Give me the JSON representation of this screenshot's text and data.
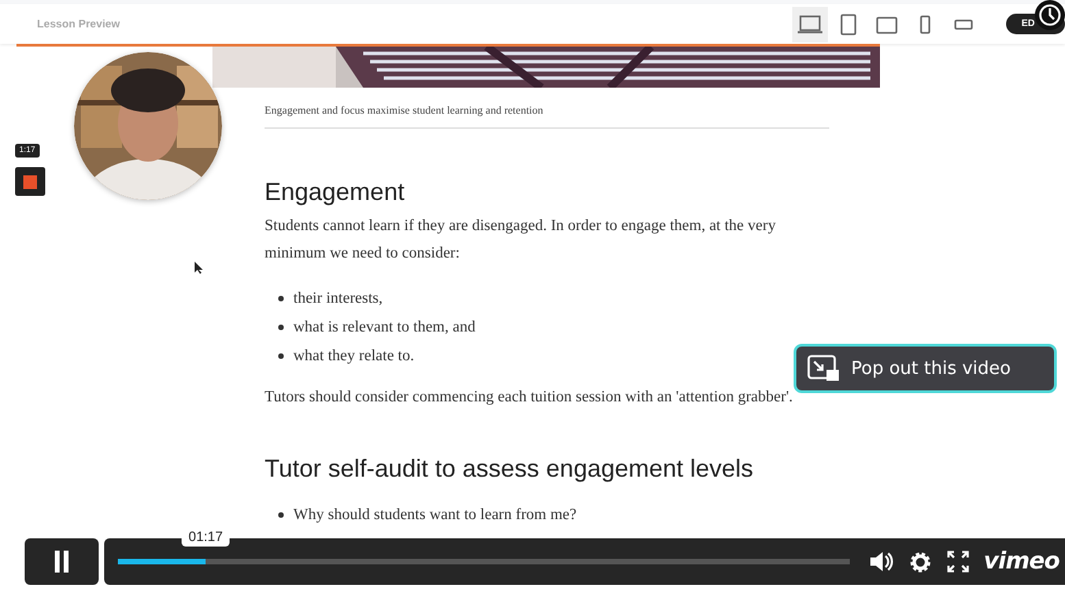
{
  "header": {
    "title": "Lesson Preview",
    "devices": [
      {
        "kind": "laptop",
        "selected": true
      },
      {
        "kind": "tablet",
        "selected": false
      },
      {
        "kind": "tablet-landscape",
        "selected": false
      },
      {
        "kind": "phone",
        "selected": false
      },
      {
        "kind": "phone-landscape",
        "selected": false
      }
    ],
    "user_badge": "ED"
  },
  "recorder": {
    "time": "1:17"
  },
  "lesson": {
    "caption": "Engagement and focus maximise student learning and retention",
    "sections": [
      {
        "heading": "Engagement",
        "intro": "Students cannot learn if they are disengaged. In order to engage them, at the very minimum we need to consider:",
        "bullets": [
          "their interests,",
          "what is relevant to them, and",
          "what they relate to."
        ],
        "outro": "Tutors should consider commencing each tuition session with an 'attention grabber'."
      },
      {
        "heading": "Tutor self-audit to assess engagement levels",
        "bullets": [
          "Why should students want to learn from me?"
        ]
      }
    ]
  },
  "popout": {
    "label": "Pop out this video"
  },
  "player": {
    "playing": true,
    "time_tooltip": "01:17",
    "level": 0.12,
    "logo": "vimeo"
  }
}
